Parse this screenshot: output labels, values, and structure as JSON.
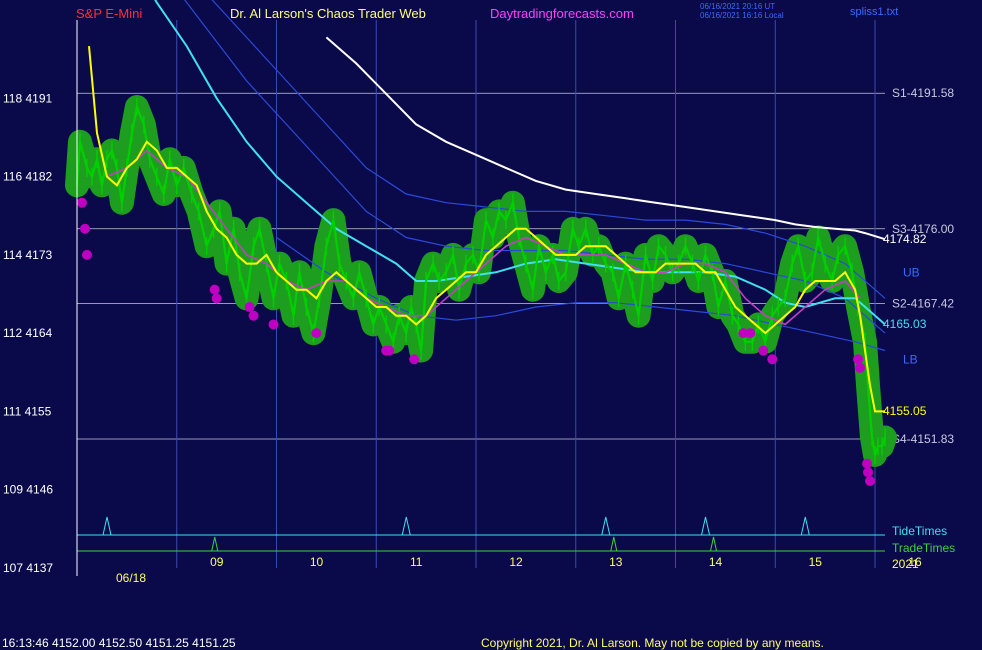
{
  "header": {
    "instrument": "S&P E-Mini",
    "site": "Dr. Al Larson's Chaos Trader Web",
    "url": "Daytradingforecasts.com",
    "stamp_utc": "06/16/2021 20:16 UT",
    "stamp_local": "06/16/2021 16:16 Local",
    "file": "spliss1.txt"
  },
  "footer": {
    "quote": "16:13:46  4152.00  4152.50  4151.25  4151.25",
    "copyright": "Copyright 2021, Dr. Al Larson. May not be copied by any means."
  },
  "colors": {
    "background": "#0a0a4a",
    "price": "#00d000",
    "glow": "#1e9e1e",
    "pivot": "#c000c0",
    "fast_ma": "#ffff00",
    "mid_ma": "#c040c0",
    "slow_ma": "#40e0f0",
    "white_ma": "#ffffff",
    "channel": "#2a4ad8",
    "hline": "#c8c8d8",
    "vline": "#3a4ab8",
    "tide": "#40e0f0",
    "trade": "#40d040"
  },
  "chart_data": {
    "type": "line",
    "y_axis": {
      "ylim": [
        4137,
        4200
      ],
      "ticks": [
        {
          "label": "118  4191",
          "price": 4191
        },
        {
          "label": "116  4182",
          "price": 4182
        },
        {
          "label": "114  4173",
          "price": 4173
        },
        {
          "label": "112  4164",
          "price": 4164
        },
        {
          "label": "111  4155",
          "price": 4155
        },
        {
          "label": "109  4146",
          "price": 4146
        },
        {
          "label": "107  4137",
          "price": 4137
        }
      ]
    },
    "x_axis": {
      "start_label": "06/18",
      "end_label": "2021",
      "ticks": [
        "09",
        "10",
        "11",
        "12",
        "13",
        "14",
        "15",
        "16"
      ]
    },
    "levels": [
      {
        "label": "S1-4191.58",
        "price": 4191.58
      },
      {
        "label": "S3-4176.00",
        "price": 4176.0
      },
      {
        "label": "S2-4167.42",
        "price": 4167.42
      },
      {
        "label": "S4-4151.83",
        "price": 4151.83
      }
    ],
    "band_labels": [
      "UB",
      "LB"
    ],
    "end_values": [
      {
        "label": "4174.82",
        "price": 4174.82,
        "color": "#ffffff"
      },
      {
        "label": "4165.03",
        "price": 4165.03,
        "color": "#40e0f0"
      },
      {
        "label": "4155.05",
        "price": 4155.05,
        "color": "#ffff00"
      }
    ],
    "time_lines": [
      "08",
      "09",
      "10",
      "11",
      "12",
      "13",
      "14",
      "15",
      "16"
    ],
    "tide_label": "TideTimes",
    "trade_label": "TradeTimes",
    "tide_spikes": [
      "08",
      "11",
      "13",
      "14",
      "15"
    ],
    "trade_spikes": [
      "09",
      "13",
      "14"
    ],
    "series": [
      {
        "kind": "price",
        "x": [
          8.0,
          8.03,
          8.1,
          8.15,
          8.2,
          8.25,
          8.3,
          8.35,
          8.4,
          8.45,
          8.5,
          8.55,
          8.6,
          8.67,
          8.73,
          8.8,
          8.87,
          8.93,
          9.0,
          9.07,
          9.15,
          9.22,
          9.3,
          9.37,
          9.43,
          9.5,
          9.57,
          9.63,
          9.7,
          9.77,
          9.83,
          9.9,
          9.97,
          10.03,
          10.1,
          10.17,
          10.23,
          10.3,
          10.37,
          10.43,
          10.5,
          10.57,
          10.63,
          10.7,
          10.77,
          10.83,
          10.9,
          10.97,
          11.03,
          11.1,
          11.17,
          11.23,
          11.3,
          11.35,
          11.4,
          11.45,
          11.5,
          11.57,
          11.63,
          11.7,
          11.77,
          11.83,
          11.9,
          11.97,
          12.03,
          12.1,
          12.17,
          12.23,
          12.3,
          12.37,
          12.43,
          12.5,
          12.57,
          12.63,
          12.7,
          12.77,
          12.83,
          12.9,
          12.97,
          13.03,
          13.1,
          13.17,
          13.23,
          13.3,
          13.37,
          13.43,
          13.5,
          13.57,
          13.63,
          13.7,
          13.77,
          13.83,
          13.9,
          13.97,
          14.03,
          14.1,
          14.17,
          14.23,
          14.3,
          14.37,
          14.43,
          14.5,
          14.57,
          14.63,
          14.7,
          14.77,
          14.83,
          14.9,
          14.97,
          15.03,
          15.1,
          15.17,
          15.23,
          15.3,
          15.37,
          15.43,
          15.5,
          15.57,
          15.63,
          15.7,
          15.77,
          15.83,
          15.9,
          15.93,
          15.97,
          16.0,
          16.03,
          16.07,
          16.1
        ],
        "y": [
          4181,
          4186,
          4183,
          4182,
          4184,
          4181,
          4184,
          4185,
          4183,
          4179,
          4183,
          4187,
          4190,
          4188,
          4184,
          4182,
          4180,
          4184,
          4181,
          4183,
          4180,
          4178,
          4174,
          4176,
          4178,
          4172,
          4176,
          4171,
          4168,
          4174,
          4176,
          4172,
          4168,
          4172,
          4170,
          4166,
          4171,
          4167,
          4164,
          4168,
          4174,
          4177,
          4172,
          4170,
          4168,
          4171,
          4168,
          4165,
          4167,
          4165,
          4163,
          4166,
          4164,
          4167,
          4165,
          4162,
          4170,
          4172,
          4170,
          4171,
          4173,
          4169,
          4172,
          4173,
          4171,
          4177,
          4175,
          4178,
          4177,
          4179,
          4175,
          4172,
          4169,
          4174,
          4171,
          4173,
          4170,
          4171,
          4176,
          4174,
          4176,
          4173,
          4174,
          4172,
          4171,
          4168,
          4172,
          4169,
          4166,
          4173,
          4170,
          4174,
          4173,
          4171,
          4172,
          4174,
          4172,
          4170,
          4173,
          4171,
          4167,
          4170,
          4166,
          4165,
          4163,
          4163,
          4165,
          4163,
          4166,
          4167,
          4168,
          4172,
          4174,
          4170,
          4171,
          4175,
          4172,
          4170,
          4173,
          4174,
          4171,
          4167,
          4163,
          4158,
          4152,
          4150,
          4151,
          4151,
          4152
        ]
      },
      {
        "kind": "fast_ma",
        "x": [
          8.12,
          8.2,
          8.3,
          8.4,
          8.5,
          8.6,
          8.7,
          8.8,
          8.9,
          9.0,
          9.1,
          9.2,
          9.3,
          9.4,
          9.5,
          9.6,
          9.7,
          9.8,
          9.9,
          10.0,
          10.1,
          10.2,
          10.3,
          10.4,
          10.5,
          10.6,
          10.7,
          10.8,
          10.9,
          11.0,
          11.1,
          11.2,
          11.3,
          11.4,
          11.5,
          11.6,
          11.7,
          11.8,
          11.9,
          12.0,
          12.1,
          12.2,
          12.3,
          12.4,
          12.5,
          12.6,
          12.7,
          12.8,
          12.9,
          13.0,
          13.1,
          13.2,
          13.3,
          13.4,
          13.5,
          13.6,
          13.7,
          13.8,
          13.9,
          14.0,
          14.1,
          14.2,
          14.3,
          14.4,
          14.5,
          14.6,
          14.7,
          14.8,
          14.9,
          15.0,
          15.1,
          15.2,
          15.3,
          15.4,
          15.5,
          15.6,
          15.7,
          15.8,
          15.85,
          15.9,
          15.95,
          16.0,
          16.05,
          16.1
        ],
        "y": [
          4197,
          4187,
          4182,
          4181,
          4183,
          4184,
          4186,
          4185,
          4183,
          4183,
          4182,
          4181,
          4178,
          4176,
          4175,
          4173,
          4172,
          4172,
          4173,
          4171,
          4170,
          4169,
          4169,
          4168,
          4170,
          4171,
          4170,
          4169,
          4168,
          4167,
          4167,
          4166,
          4166,
          4165,
          4166,
          4168,
          4169,
          4170,
          4171,
          4171,
          4173,
          4174,
          4175,
          4176,
          4176,
          4175,
          4174,
          4173,
          4173,
          4173,
          4174,
          4174,
          4174,
          4173,
          4172,
          4171,
          4171,
          4171,
          4172,
          4172,
          4172,
          4172,
          4171,
          4171,
          4169,
          4167,
          4166,
          4165,
          4164,
          4165,
          4166,
          4167,
          4169,
          4170,
          4170,
          4170,
          4171,
          4169,
          4166,
          4162,
          4158,
          4155,
          4155,
          4155
        ]
      },
      {
        "kind": "mid_ma",
        "x": [
          8.3,
          8.5,
          8.7,
          8.9,
          9.1,
          9.3,
          9.5,
          9.7,
          9.9,
          10.1,
          10.3,
          10.5,
          10.7,
          10.9,
          11.1,
          11.3,
          11.5,
          11.7,
          11.9,
          12.1,
          12.3,
          12.5,
          12.7,
          12.9,
          13.1,
          13.3,
          13.5,
          13.7,
          13.9,
          14.1,
          14.3,
          14.5,
          14.7,
          14.9,
          15.1,
          15.3,
          15.5,
          15.7,
          15.85
        ],
        "y": [
          4182,
          4183,
          4185,
          4183,
          4182,
          4179,
          4176,
          4173,
          4172,
          4170,
          4169,
          4170,
          4170,
          4168,
          4167,
          4166,
          4166,
          4168,
          4170,
          4172,
          4174,
          4175,
          4174,
          4173,
          4173,
          4173,
          4172,
          4171,
          4171,
          4172,
          4172,
          4171,
          4168,
          4166,
          4165,
          4167,
          4169,
          4170,
          4168
        ]
      },
      {
        "kind": "slow_ma",
        "x": [
          8.5,
          8.8,
          9.1,
          9.4,
          9.7,
          10.0,
          10.3,
          10.6,
          10.9,
          11.2,
          11.4,
          11.6,
          11.9,
          12.2,
          12.5,
          12.8,
          13.1,
          13.4,
          13.7,
          14.0,
          14.3,
          14.6,
          14.9,
          15.1,
          15.3,
          15.6,
          15.8,
          16.1
        ],
        "y": [
          4208,
          4202,
          4197,
          4191,
          4186,
          4182,
          4179,
          4176,
          4174,
          4172,
          4170,
          4170,
          4170.5,
          4171,
          4172,
          4172.5,
          4172,
          4171.5,
          4171,
          4171,
          4171,
          4170.5,
          4169,
          4167.5,
          4167,
          4168,
          4168,
          4165
        ]
      },
      {
        "kind": "white_ma",
        "x": [
          10.5,
          10.8,
          11.1,
          11.4,
          11.7,
          12.0,
          12.3,
          12.6,
          12.9,
          13.2,
          13.5,
          13.8,
          14.1,
          14.4,
          14.7,
          15.0,
          15.2,
          15.4,
          15.6,
          15.8,
          15.9,
          16.1
        ],
        "y": [
          4198,
          4195,
          4191.5,
          4188,
          4186,
          4184.5,
          4183,
          4181.5,
          4180.5,
          4180,
          4179.5,
          4179,
          4178.5,
          4178,
          4177.5,
          4177,
          4176.5,
          4176.2,
          4176,
          4175.8,
          4175.5,
          4174.8
        ]
      },
      {
        "kind": "channel",
        "x": [
          8.9,
          9.3,
          9.7,
          10.1,
          10.5,
          10.9,
          11.3,
          11.7,
          12.1,
          12.5,
          12.9,
          13.3,
          13.7,
          14.1,
          14.5,
          14.9,
          15.3,
          15.7,
          16.1
        ],
        "y": [
          4208,
          4203,
          4198,
          4193,
          4188,
          4183,
          4180,
          4179,
          4178.5,
          4178,
          4178,
          4177.5,
          4177,
          4177,
          4176.5,
          4175.5,
          4174,
          4172,
          4168
        ]
      },
      {
        "kind": "channel",
        "x": [
          8.9,
          9.3,
          9.7,
          10.1,
          10.5,
          10.9,
          11.3,
          11.7,
          12.1,
          12.5,
          12.9,
          13.3,
          13.7,
          14.1,
          14.5,
          14.9,
          15.3,
          15.7,
          16.1
        ],
        "y": [
          4205,
          4199,
          4193,
          4188,
          4183,
          4178,
          4175,
          4174,
          4173.5,
          4173.5,
          4173.5,
          4173,
          4172.5,
          4172.5,
          4172,
          4171,
          4170,
          4168,
          4164
        ]
      },
      {
        "kind": "channel",
        "x": [
          10.0,
          10.5,
          11.0,
          11.4,
          11.8,
          12.2,
          12.6,
          13.0,
          13.4,
          13.8,
          14.2,
          14.6,
          15.0,
          15.4,
          15.8,
          16.1
        ],
        "y": [
          4175,
          4171,
          4168,
          4166,
          4165.5,
          4166,
          4167,
          4167.5,
          4167.5,
          4167,
          4166.5,
          4166,
          4165,
          4164,
          4163,
          4162
        ]
      },
      {
        "kind": "pivots",
        "x": [
          8.05,
          8.08,
          8.1,
          9.38,
          9.4,
          9.73,
          9.77,
          9.97,
          10.4,
          11.1,
          11.13,
          11.38,
          14.68,
          14.75,
          14.88,
          14.97,
          15.83,
          15.85,
          15.92,
          15.93,
          15.95
        ],
        "y": [
          4179,
          4176,
          4173,
          4169,
          4168,
          4167,
          4166,
          4165,
          4164,
          4162,
          4162,
          4161,
          4164,
          4164,
          4162,
          4161,
          4161,
          4160,
          4149,
          4148,
          4147
        ]
      }
    ]
  }
}
